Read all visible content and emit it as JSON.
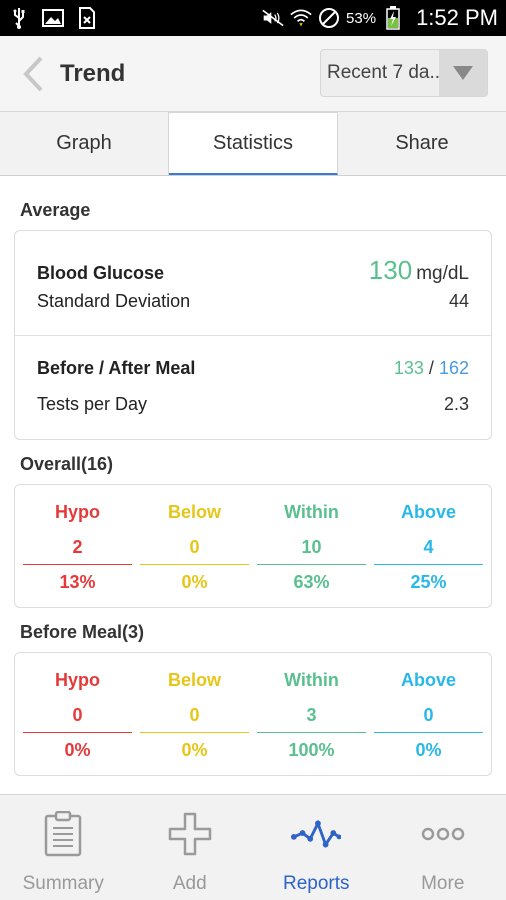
{
  "status_bar": {
    "battery_pct": "53%",
    "time": "1:52 PM"
  },
  "header": {
    "title": "Trend",
    "range_value": "Recent 7 da..."
  },
  "tabs": [
    {
      "label": "Graph"
    },
    {
      "label": "Statistics"
    },
    {
      "label": "Share"
    }
  ],
  "average": {
    "title": "Average",
    "blood_glucose_label": "Blood Glucose",
    "blood_glucose_value": "130",
    "blood_glucose_unit": "mg/dL",
    "std_dev_label": "Standard Deviation",
    "std_dev_value": "44",
    "before_after_label": "Before / After Meal",
    "before_value": "133",
    "separator": "/",
    "after_value": "162",
    "tests_per_day_label": "Tests per Day",
    "tests_per_day_value": "2.3"
  },
  "overall": {
    "title": "Overall(16)",
    "cols": [
      {
        "label": "Hypo",
        "count": "2",
        "pct": "13%"
      },
      {
        "label": "Below",
        "count": "0",
        "pct": "0%"
      },
      {
        "label": "Within",
        "count": "10",
        "pct": "63%"
      },
      {
        "label": "Above",
        "count": "4",
        "pct": "25%"
      }
    ]
  },
  "before_meal": {
    "title": "Before Meal(3)",
    "cols": [
      {
        "label": "Hypo",
        "count": "0",
        "pct": "0%"
      },
      {
        "label": "Below",
        "count": "0",
        "pct": "0%"
      },
      {
        "label": "Within",
        "count": "3",
        "pct": "100%"
      },
      {
        "label": "Above",
        "count": "0",
        "pct": "0%"
      }
    ]
  },
  "bottom_nav": [
    {
      "label": "Summary",
      "icon": "clipboard-icon"
    },
    {
      "label": "Add",
      "icon": "plus-icon"
    },
    {
      "label": "Reports",
      "icon": "trend-line-icon"
    },
    {
      "label": "More",
      "icon": "more-dots-icon"
    }
  ],
  "colors": {
    "hypo": "#e63a3a",
    "below": "#e6c619",
    "within": "#5ac08f",
    "above": "#29b8e8",
    "accent": "#2e63c7"
  }
}
